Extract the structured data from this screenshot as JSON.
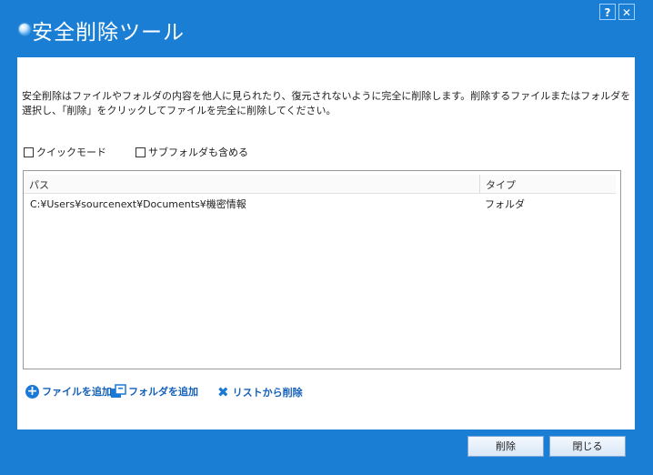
{
  "window": {
    "title": "安全削除ツール",
    "help_label": "?",
    "close_label": "✕"
  },
  "description": "安全削除はファイルやフォルダの内容を他人に見られたり、復元されないように完全に削除します。削除するファイルまたはフォルダを選択し、「削除」をクリックしてファイルを完全に削除してください。",
  "options": {
    "quick_mode": {
      "label": "クイックモード",
      "checked": false
    },
    "include_subfolders": {
      "label": "サブフォルダも含める",
      "checked": false
    }
  },
  "list": {
    "columns": [
      "パス",
      "タイプ"
    ],
    "rows": [
      {
        "path": "C:¥Users¥sourcenext¥Documents¥機密情報",
        "type": "フォルダ"
      }
    ]
  },
  "actions": {
    "add_file": "ファイルを追加",
    "add_folder": "フォルダを追加",
    "remove_from_list": "リストから削除"
  },
  "buttons": {
    "delete": "削除",
    "close": "閉じる"
  },
  "colors": {
    "frame": "#1a7fd4",
    "link": "#1560b8"
  }
}
